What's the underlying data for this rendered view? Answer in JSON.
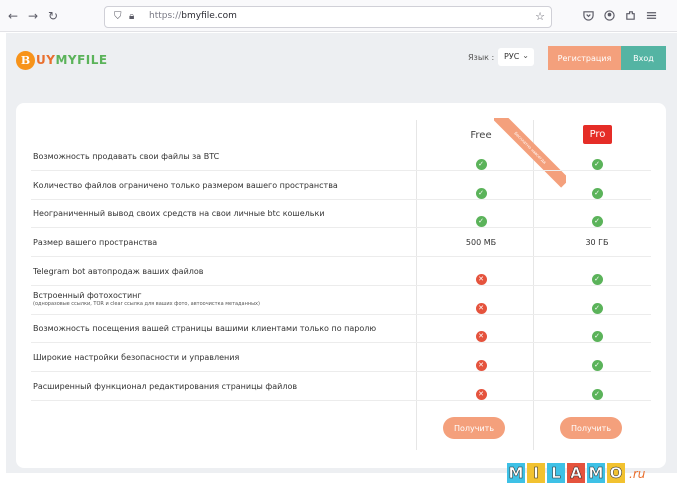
{
  "browser": {
    "url_proto": "https://",
    "url_host": "bmyfile.com",
    "back_icon": "arrow-left-icon",
    "forward_icon": "arrow-right-icon",
    "reload_icon": "reload-icon"
  },
  "header": {
    "logo_letter": "B",
    "logo_prefix": "UY",
    "logo_rest": "MYFILE",
    "lang_label": "Язык :",
    "lang_value": "РУС",
    "register_label": "Регистрация",
    "login_label": "Вход"
  },
  "plans": {
    "free_title": "Free",
    "pro_title": "Pro",
    "ribbon_text": "Бесплатно навсегда",
    "get_label": "Получить"
  },
  "features": [
    {
      "label": "Возможность продавать свои файлы за BTC",
      "sub": "",
      "free": "yes",
      "pro": "yes"
    },
    {
      "label": "Количество файлов ограничено только размером вашего пространства",
      "sub": "",
      "free": "yes",
      "pro": "yes"
    },
    {
      "label": "Неограниченный вывод своих средств на свои личные btc кошельки",
      "sub": "",
      "free": "yes",
      "pro": "yes"
    },
    {
      "label": "Размер вашего пространства",
      "sub": "",
      "free_text": "500 МБ",
      "pro_text": "30 ГБ"
    },
    {
      "label": "Telegram bot автопродаж ваших файлов",
      "sub": "",
      "free": "no",
      "pro": "yes"
    },
    {
      "label": "Встроенный фотохостинг",
      "sub": "(одноразовые ссылки, TOR и clear ссылка для ваших фото, автоочистка метаданных)",
      "free": "no",
      "pro": "yes"
    },
    {
      "label": "Возможность посещения вашей страницы вашими клиентами только по паролю",
      "sub": "",
      "free": "no",
      "pro": "yes"
    },
    {
      "label": "Широкие настройки безопасности и управления",
      "sub": "",
      "free": "no",
      "pro": "yes"
    },
    {
      "label": "Расширенный функционал редактирования страницы файлов",
      "sub": "",
      "free": "no",
      "pro": "yes"
    }
  ],
  "watermark": {
    "letters": [
      "M",
      "I",
      "L",
      "A",
      "M",
      "O"
    ],
    "letter_colors": [
      "#3ec1e6",
      "#f2c230",
      "#3ec1e6",
      "#e5533d",
      "#3ec1e6",
      "#f2c230"
    ],
    "domain": ".ru"
  },
  "colors": {
    "accent": "#f4a07c",
    "login": "#54b4a3",
    "yes": "#5bb35a",
    "no": "#e5533d",
    "pro_badge": "#e52d27"
  }
}
